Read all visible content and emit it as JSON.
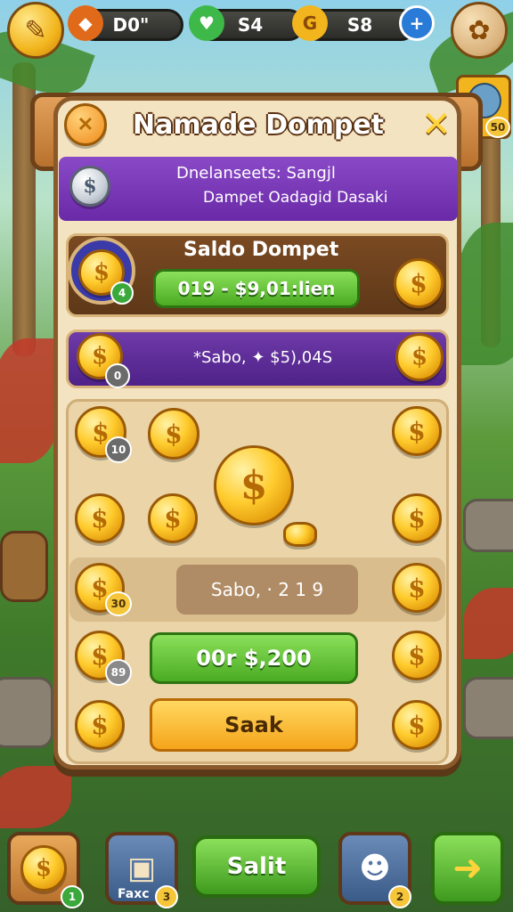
{
  "top_bar": {
    "left_button_icon": "coin-icon",
    "pill_1_value": "D0\"",
    "pill_2_value": "S4",
    "pill_3_value": "S8",
    "plus_icon": "plus-icon",
    "profile_badge": "50"
  },
  "dialog": {
    "title": "Namade Dompet",
    "close_icon": "close-icon",
    "header_line1": "Dnelanseets: Sangjl",
    "header_line2": "Dampet  Oadagid  Dasaki",
    "balance_card": {
      "label": "Saldo Dompet",
      "value": "019 - $9,01:lien",
      "badge": "4"
    },
    "info_row": {
      "text": "*Sabo, ✦ $5),04S",
      "badge": "0"
    },
    "grid_badges": [
      "10",
      "30",
      "89"
    ],
    "saldo_row": "Sabo, · 2 1 9",
    "green_button": "00r $,200",
    "orange_button": "Saak"
  },
  "bottom_bar": {
    "btn1_badge": "1",
    "btn2_label": "Faxc",
    "btn2_badge": "3",
    "center_button": "Salit",
    "btn4_badge": "2"
  },
  "colors": {
    "panel": "#f3e3c0",
    "frame": "#8a5a2a",
    "purple": "#6e3aa8",
    "green": "#4aab22",
    "orange": "#f5a51a",
    "gold": "#ffcc2e"
  }
}
